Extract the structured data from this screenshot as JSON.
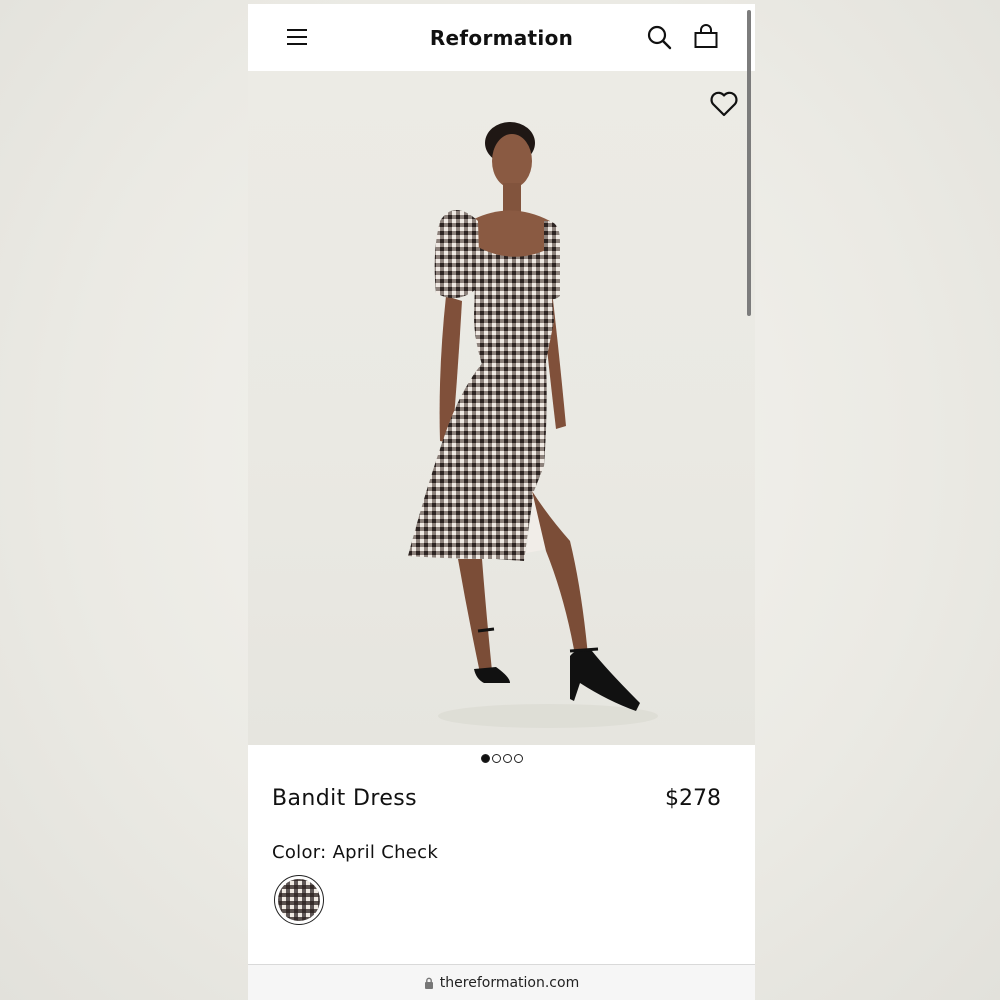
{
  "header": {
    "brand": "Reformation",
    "menu_icon": "hamburger-menu-icon",
    "search_icon": "search-icon",
    "bag_icon": "shopping-bag-icon"
  },
  "hero": {
    "wishlist_icon": "heart-icon",
    "image_count": 4,
    "active_image": 1
  },
  "product": {
    "name": "Bandit Dress",
    "price": "$278",
    "color_label": "Color: April Check",
    "swatch_icon": "gingham-swatch"
  },
  "browser": {
    "url": "thereformation.com",
    "lock_icon": "lock-icon"
  },
  "colors": {
    "background": "#ebeae4",
    "text": "#111111",
    "photo_background": "#eae9e3"
  }
}
